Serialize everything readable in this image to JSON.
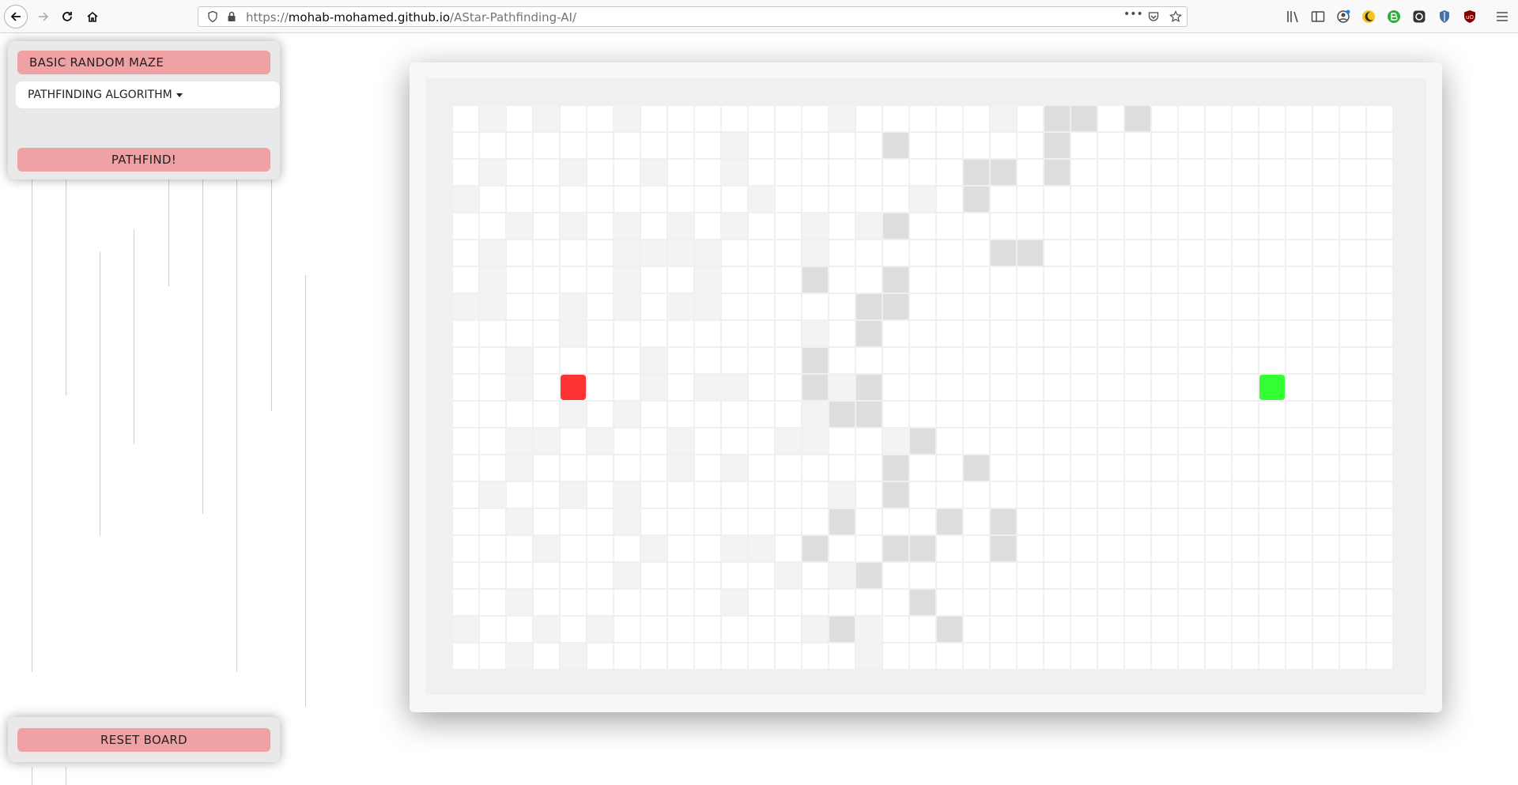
{
  "browser": {
    "url_prefix": "https://",
    "url_host": "mohab-mohamed.github.io",
    "url_path": "/AStar-Pathfinding-AI/",
    "more_glyph": "•••"
  },
  "controls": {
    "maze_button": "BASIC RANDOM MAZE",
    "algorithm_dropdown": "PATHFINDING ALGORITHM",
    "pathfind_button": "PATHFIND!",
    "reset_button": "RESET BOARD"
  },
  "colors": {
    "button": "#f0a1a3",
    "panel": "#e9e9e9",
    "start_node": "#ff3333",
    "end_node": "#33ff33",
    "wall_light": "#f3f3f3",
    "wall_dark": "#dedede",
    "empty": "#ffffff"
  },
  "board": {
    "rows": 21,
    "cols": 35,
    "start_node": [
      10,
      4
    ],
    "end_node": [
      10,
      30
    ],
    "legend": "rows of grid: '.' empty cell, 'l' light wall, 'd' dark wall, 'S' start node, 'E' end node",
    "grid": [
      ".l.l..l.......l.....l.dd.d.........",
      "..........l.....d.....d............",
      ".l..l..l..l........dd.d............",
      "l..........l.....l.d...............",
      "..l.l.l.l.l..l.ld..................",
      ".l....llll...l......dd.............",
      ".l....l..l...d..d..................",
      "ll..l.l.ll.....dd..................",
      "....l........l.d..................",
      "..l....l.....d.........................",
      "..l.S..l.ll..dld.........E.........",
      "....l.l......ldd...................",
      "..ll.l..l...ll..ld.................",
      "..l.....l.l.....d..d...............",
      ".l..l.l.......l.d..................",
      "..l...l.......d...d.d..............",
      "...l...l..ll.d..dd..d..............",
      "......l.....l.ld...................",
      "..l.......l......d.................",
      "l..l.l.......ldl..d................",
      "..l.l..........l..................."
    ]
  }
}
